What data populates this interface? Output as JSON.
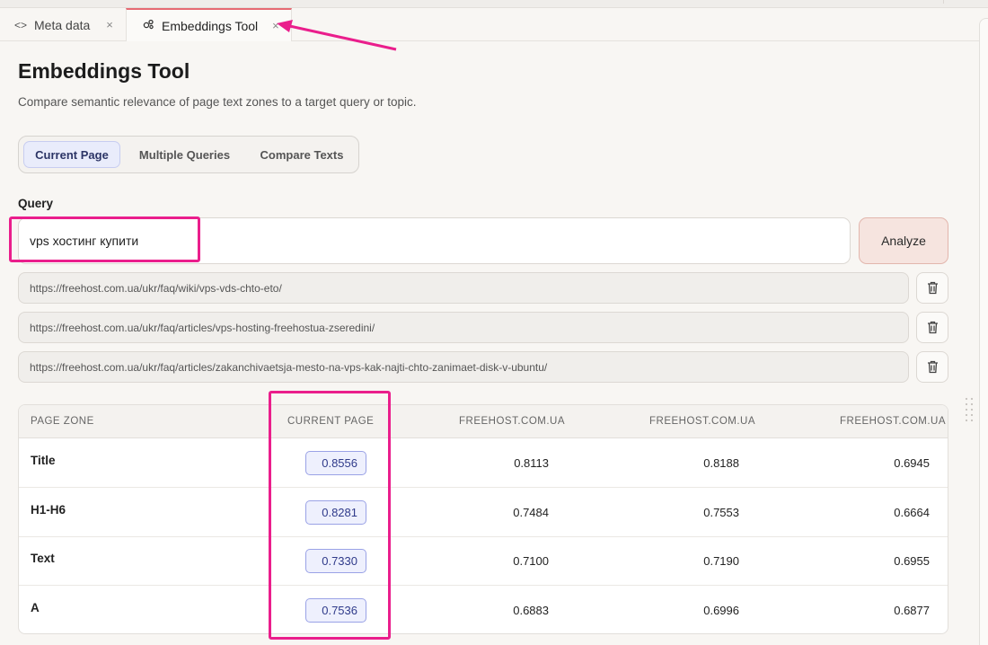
{
  "tabs": [
    {
      "icon": "code-icon",
      "label": "Meta data",
      "close": "×"
    },
    {
      "icon": "embeddings-icon",
      "label": "Embeddings Tool",
      "close": "×"
    }
  ],
  "page": {
    "title": "Embeddings Tool",
    "subtitle": "Compare semantic relevance of page text zones to a target query or topic."
  },
  "modes": [
    {
      "label": "Current Page",
      "active": true
    },
    {
      "label": "Multiple Queries",
      "active": false
    },
    {
      "label": "Compare Texts",
      "active": false
    }
  ],
  "query": {
    "label": "Query",
    "value": "vps хостинг купити",
    "analyze_label": "Analyze"
  },
  "urls": [
    "https://freehost.com.ua/ukr/faq/wiki/vps-vds-chto-eto/",
    "https://freehost.com.ua/ukr/faq/articles/vps-hosting-freehostua-zseredini/",
    "https://freehost.com.ua/ukr/faq/articles/zakanchivaetsja-mesto-na-vps-kak-najti-chto-zanimaet-disk-v-ubuntu/"
  ],
  "table": {
    "headers": [
      "PAGE ZONE",
      "CURRENT PAGE",
      "FREEHOST.COM.UA",
      "FREEHOST.COM.UA",
      "FREEHOST.COM.UA"
    ],
    "rows": [
      {
        "zone": "Title",
        "current": "0.8556",
        "u1": "0.8113",
        "u2": "0.8188",
        "u3": "0.6945"
      },
      {
        "zone": "H1-H6",
        "current": "0.8281",
        "u1": "0.7484",
        "u2": "0.7553",
        "u3": "0.6664"
      },
      {
        "zone": "Text",
        "current": "0.7330",
        "u1": "0.7100",
        "u2": "0.7190",
        "u3": "0.6955"
      },
      {
        "zone": "A",
        "current": "0.7536",
        "u1": "0.6883",
        "u2": "0.6996",
        "u3": "0.6877"
      }
    ]
  },
  "colors": {
    "accent_tab": "#e66a73",
    "highlight": "#ea1e8c",
    "badge_border": "#9aa2e6",
    "analyze_bg": "#f6e4df"
  }
}
